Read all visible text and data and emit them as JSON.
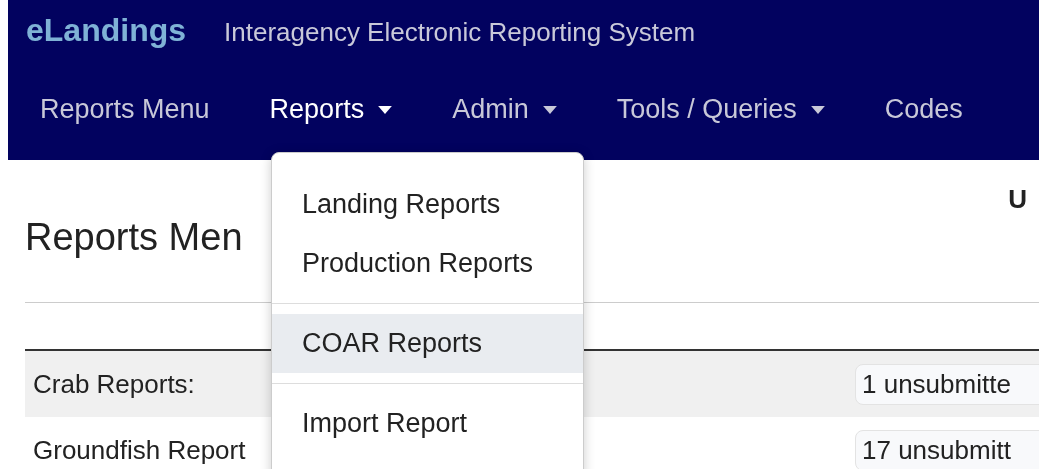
{
  "header": {
    "brand": "eLandings",
    "subtitle": "Interagency Electronic Reporting System"
  },
  "nav": [
    {
      "label": "Reports Menu",
      "kind": "link",
      "expanded": false
    },
    {
      "label": "Reports",
      "kind": "dropdown",
      "expanded": true
    },
    {
      "label": "Admin",
      "kind": "dropdown",
      "expanded": false
    },
    {
      "label": "Tools / Queries",
      "kind": "dropdown",
      "expanded": false
    },
    {
      "label": "Codes",
      "kind": "link",
      "expanded": false
    }
  ],
  "dropdown_menu": {
    "groups": [
      [
        {
          "label": "Landing Reports",
          "highlighted": false
        },
        {
          "label": "Production Reports",
          "highlighted": false
        }
      ],
      [
        {
          "label": "COAR Reports",
          "highlighted": true
        }
      ],
      [
        {
          "label": "Import Report",
          "highlighted": false
        }
      ]
    ]
  },
  "user_label": "U",
  "page_title": "Reports Men",
  "report_rows": [
    {
      "label": "Crab Reports:",
      "badge": "1 unsubmitte"
    },
    {
      "label": "Groundfish Report",
      "badge": "17 unsubmitt"
    }
  ]
}
